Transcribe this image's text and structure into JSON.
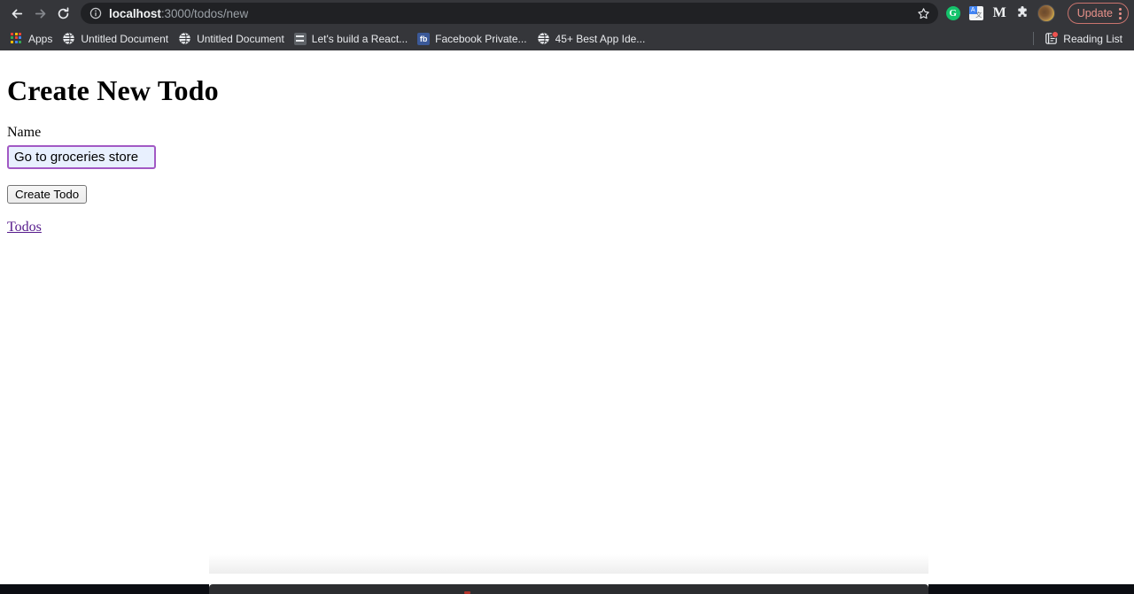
{
  "browser": {
    "nav": {
      "back_icon": "arrow-left-icon",
      "forward_icon": "arrow-right-icon",
      "reload_icon": "reload-icon"
    },
    "omnibox": {
      "info_icon": "info-circle-icon",
      "url_host": "localhost",
      "url_path": ":3000/todos/new",
      "full_url": "localhost:3000/todos/new",
      "star_icon": "star-outline-icon"
    },
    "extensions": [
      {
        "name": "grammarly-extension-icon",
        "glyph": "G"
      },
      {
        "name": "google-translate-extension-icon",
        "glyph": "文"
      },
      {
        "name": "medium-extension-icon",
        "glyph": "M"
      },
      {
        "name": "extensions-puzzle-icon",
        "glyph": "puzzle"
      }
    ],
    "avatar": {
      "name": "profile-avatar"
    },
    "update_button": {
      "label": "Update"
    },
    "menu": {
      "name": "chrome-menu-kebab-icon"
    },
    "bookmarks": [
      {
        "label": "Apps",
        "icon": "apps-grid-icon"
      },
      {
        "label": "Untitled Document",
        "icon": "globe-icon"
      },
      {
        "label": "Untitled Document",
        "icon": "globe-icon"
      },
      {
        "label": "Let's build a React...",
        "icon": "document-icon"
      },
      {
        "label": "Facebook Private...",
        "icon": "facebook-icon"
      },
      {
        "label": "45+ Best App Ide...",
        "icon": "globe-icon"
      }
    ],
    "reading_list": {
      "label": "Reading List",
      "icon": "reading-list-icon",
      "has_badge": true
    }
  },
  "content": {
    "title": "Create New Todo",
    "form": {
      "name_label": "Name",
      "name_value": "Go to groceries store",
      "name_placeholder": "",
      "submit_label": "Create Todo"
    },
    "todos_link": "Todos"
  },
  "colors": {
    "chrome_bg": "#35363a",
    "omnibox_bg": "#202124",
    "page_bg": "#ffffff",
    "input_border": "#a259c4",
    "input_fill": "#e8f0fe",
    "link_visited": "#551a8b",
    "update_accent": "#e8918a",
    "badge_red": "#ef5350"
  }
}
